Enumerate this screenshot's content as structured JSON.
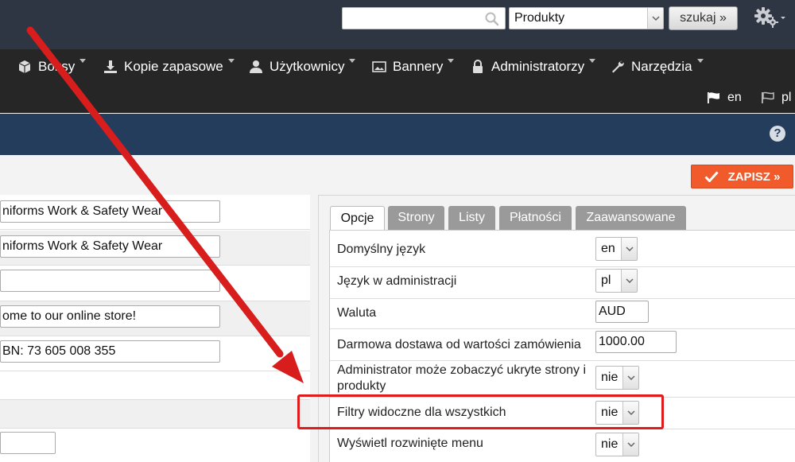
{
  "header": {
    "search": {
      "value": "",
      "placeholder": ""
    },
    "category_select": {
      "value": "Produkty"
    },
    "search_button": "szukaj »"
  },
  "nav": {
    "items": [
      {
        "label": "Boksy",
        "icon": "box-icon"
      },
      {
        "label": "Kopie zapasowe",
        "icon": "download-icon"
      },
      {
        "label": "Użytkownicy",
        "icon": "user-icon"
      },
      {
        "label": "Bannery",
        "icon": "image-icon"
      },
      {
        "label": "Administratorzy",
        "icon": "lock-icon"
      },
      {
        "label": "Narzędzia",
        "icon": "wrench-icon"
      }
    ],
    "languages": [
      {
        "code": "en"
      },
      {
        "code": "pl"
      }
    ]
  },
  "toolbar": {
    "help": "?",
    "save_label": "ZAPISZ »"
  },
  "left_fields": [
    {
      "value": "niforms Work & Safety Wear"
    },
    {
      "value": "niforms Work & Safety Wear"
    },
    {
      "value": ""
    },
    {
      "value": "ome to our online store!"
    },
    {
      "value": "BN: 73 605 008 355"
    },
    {
      "value": ""
    }
  ],
  "tabs": [
    {
      "label": "Opcje",
      "active": true
    },
    {
      "label": "Strony",
      "active": false
    },
    {
      "label": "Listy",
      "active": false
    },
    {
      "label": "Płatności",
      "active": false
    },
    {
      "label": "Zaawansowane",
      "active": false
    }
  ],
  "options": [
    {
      "label": "Domyślny język",
      "value": "en"
    },
    {
      "label": "Język w administracji",
      "value": "pl"
    },
    {
      "label": "Waluta",
      "value": "AUD"
    },
    {
      "label": "Darmowa dostawa od wartości zamówienia",
      "value": "1000.00"
    },
    {
      "label": "Administrator może zobaczyć ukryte strony i produkty",
      "value": "nie"
    },
    {
      "label": "Filtry widoczne dla wszystkich",
      "value": "nie"
    },
    {
      "label": "Wyświetl rozwinięte menu",
      "value": "nie"
    }
  ],
  "colors": {
    "topbar": "#2d3642",
    "navbar": "#262626",
    "bluebar": "#253d5d",
    "save": "#f15a2b",
    "highlight": "#e01b1b"
  }
}
